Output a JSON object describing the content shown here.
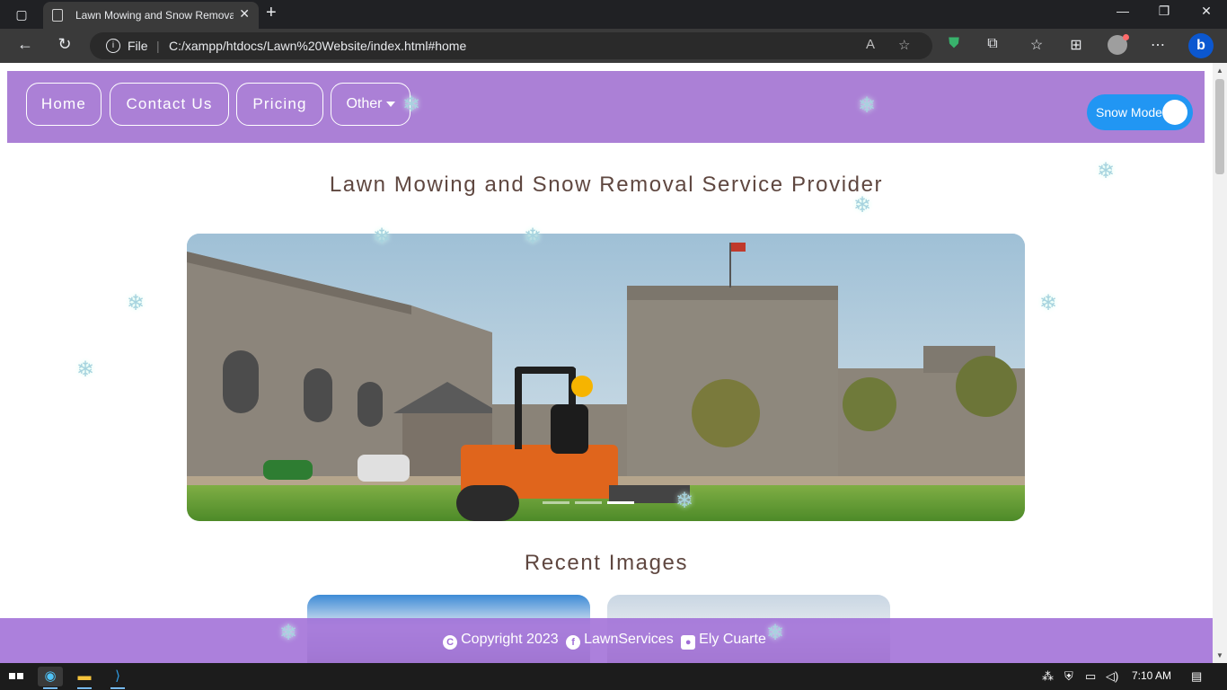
{
  "browser": {
    "tab_title": "Lawn Mowing and Snow Removal",
    "scheme_label": "File",
    "url": "C:/xampp/htdocs/Lawn%20Website/index.html#home"
  },
  "nav": {
    "items": [
      {
        "label": "Home"
      },
      {
        "label": "Contact Us"
      },
      {
        "label": "Pricing"
      },
      {
        "label": "Other"
      }
    ],
    "toggle_label": "Snow Mode"
  },
  "page": {
    "title": "Lawn Mowing and Snow Removal Service Provider",
    "recent_title": "Recent Images"
  },
  "slider": {
    "slide_count": 3,
    "active_slide": 3
  },
  "footer": {
    "copyright": "Copyright 2023",
    "social": "LawnServices",
    "author": "Ely Cuarte"
  },
  "taskbar": {
    "time": "7:10 AM"
  },
  "colors": {
    "navbar": "#ab80d6",
    "toggle": "#2196f3",
    "heading": "#5f4740",
    "footer": "#a06ed7"
  },
  "icons": [
    "window-icon",
    "page-icon",
    "back-icon",
    "refresh-icon",
    "info-icon",
    "read-aloud-icon",
    "favorite-add-icon",
    "shield-icon",
    "extensions-icon",
    "favorites-icon",
    "collections-icon",
    "profile-icon",
    "more-icon",
    "bing-icon",
    "snowflake-icon",
    "copyright-icon",
    "facebook-icon",
    "user-icon",
    "windows-start-icon",
    "edge-icon",
    "file-explorer-icon",
    "vscode-icon"
  ]
}
